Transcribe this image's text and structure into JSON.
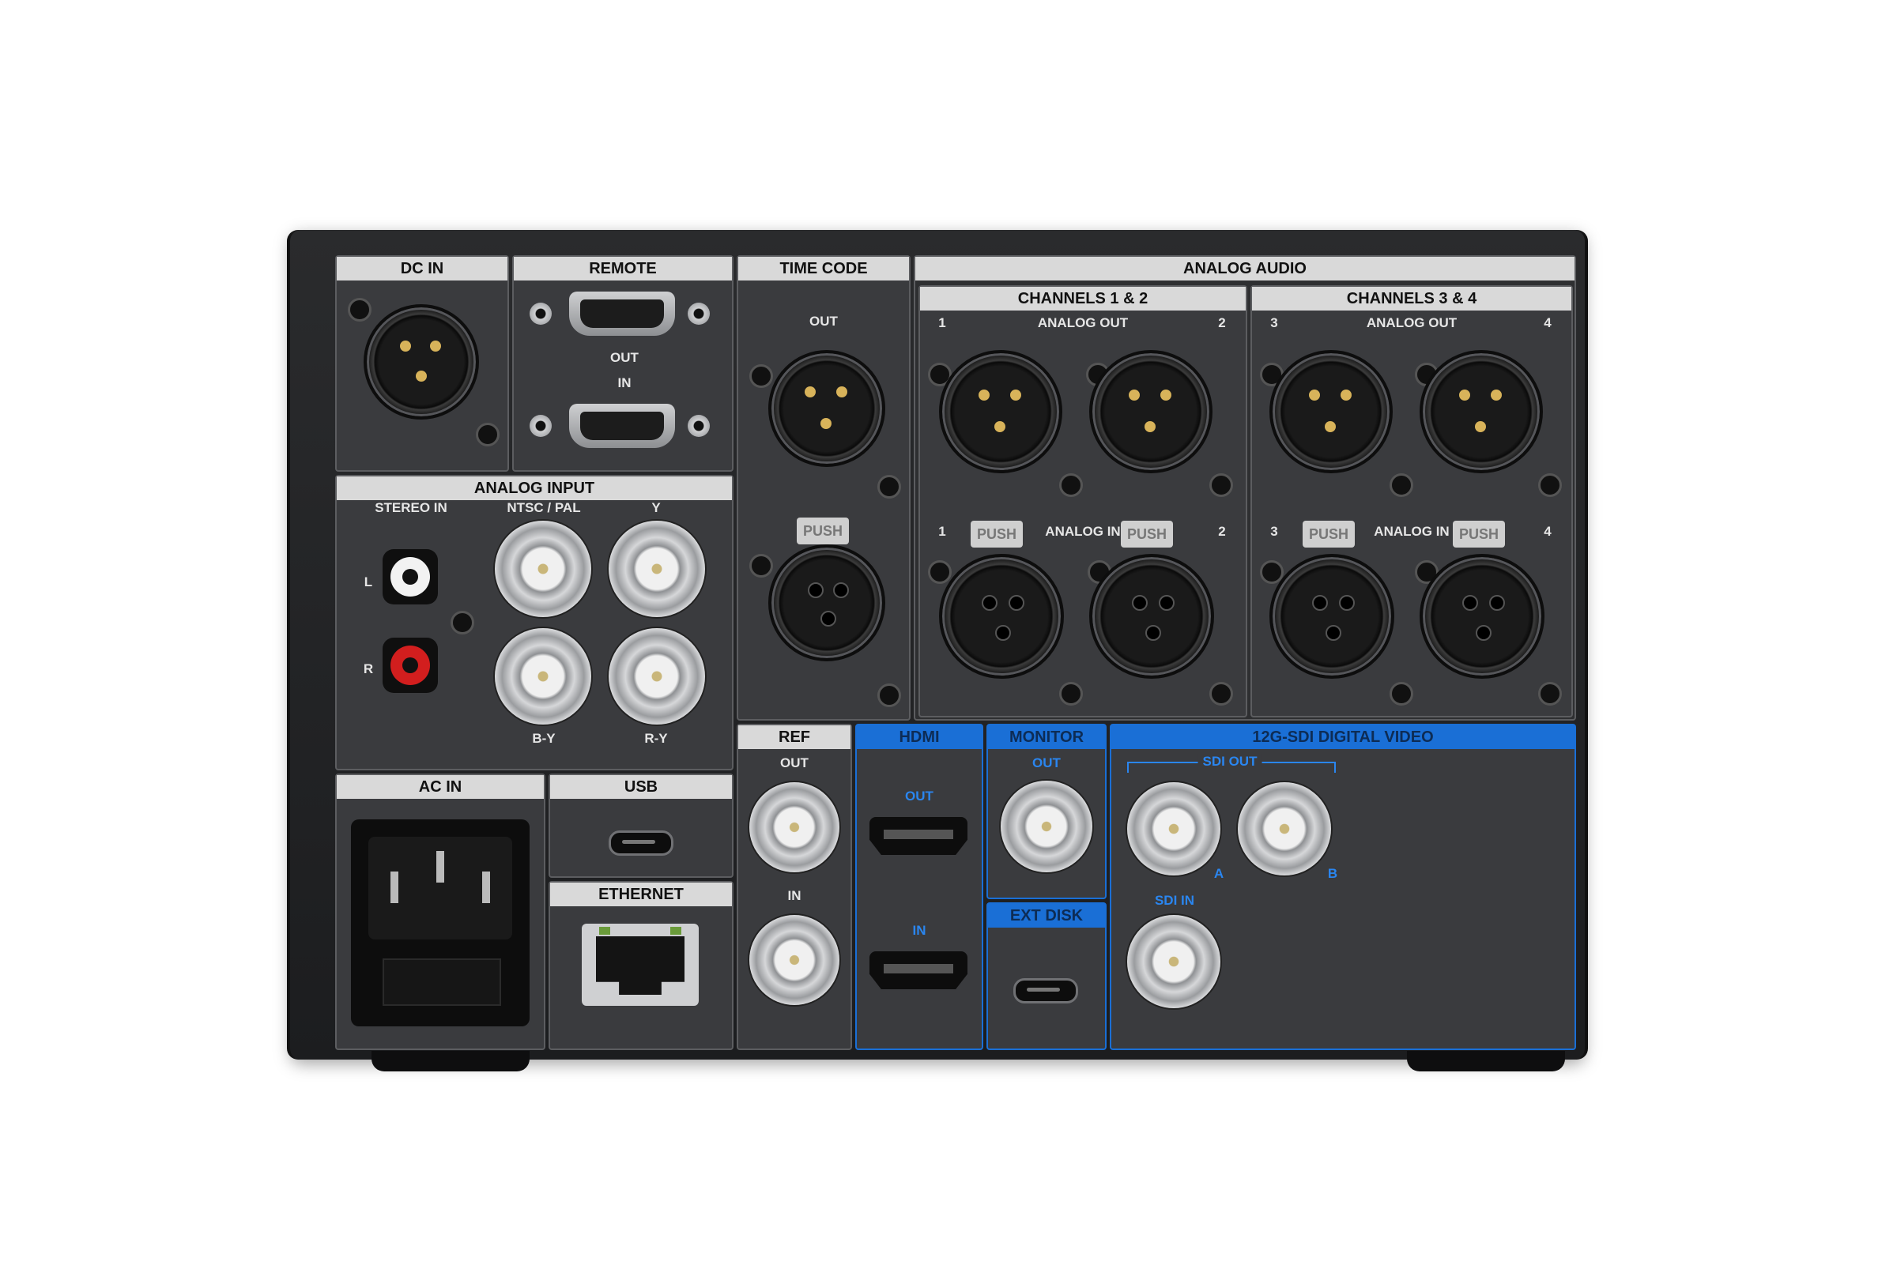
{
  "panels": {
    "dc_in": "DC IN",
    "remote": "REMOTE",
    "time_code": "TIME CODE",
    "analog_audio": "ANALOG AUDIO",
    "channels_1_2": "CHANNELS 1 & 2",
    "channels_3_4": "CHANNELS 3 & 4",
    "analog_input": "ANALOG INPUT",
    "ac_in": "AC IN",
    "usb": "USB",
    "ethernet": "ETHERNET",
    "ref": "REF",
    "hdmi": "HDMI",
    "monitor": "MONITOR",
    "ext_disk": "EXT DISK",
    "sdi": "12G-SDI DIGITAL VIDEO"
  },
  "labels": {
    "out": "OUT",
    "in": "IN",
    "analog_out": "ANALOG OUT",
    "analog_in": "ANALOG IN",
    "stereo_in": "STEREO IN",
    "ntsc_pal": "NTSC / PAL",
    "y": "Y",
    "by": "B-Y",
    "ry": "R-Y",
    "l": "L",
    "r": "R",
    "ch1": "1",
    "ch2": "2",
    "ch3": "3",
    "ch4": "4",
    "sdi_out": "SDI OUT",
    "sdi_in": "SDI IN",
    "a": "A",
    "b": "B",
    "push": "PUSH"
  },
  "colors": {
    "chassis": "#222325",
    "panel": "#3a3b3e",
    "header": "#d9d9d9",
    "accent_blue": "#1a6fd6"
  }
}
